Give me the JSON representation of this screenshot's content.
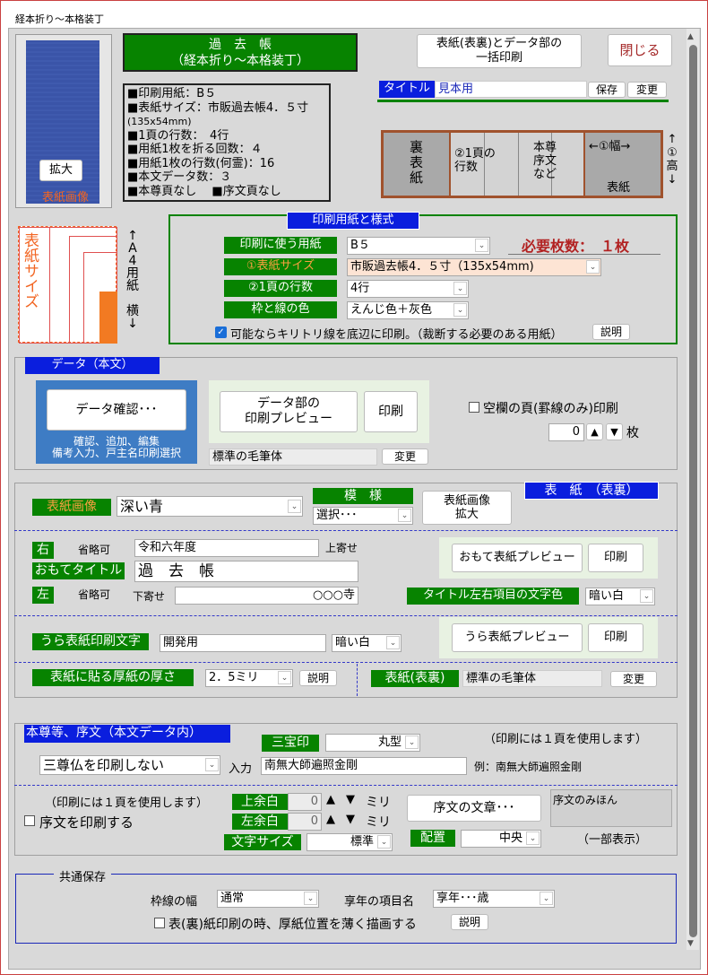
{
  "window": {
    "title": "経本折り～本格装丁"
  },
  "header": {
    "title_line1": "過　去　帳",
    "title_line2": "（経本折り～本格装丁）",
    "batch_print": "表紙(表裏)とデータ部の\n一括印刷",
    "close": "閉じる"
  },
  "cover_thumb": {
    "zoom": "拡大",
    "label": "表紙画像"
  },
  "info_lines": [
    "■印刷用紙：B５",
    "■表紙サイズ：市販過去帳4．５寸",
    "(135x54mm)",
    "■1頁の行数：　4行",
    "■用紙1枚を折る回数：４",
    "■用紙1枚の行数(何霊)：16",
    "■本文データ数：３",
    "■本尊頁なし　 ■序文頁なし"
  ],
  "title_row": {
    "label": "タイトル",
    "value": "見本用",
    "save": "保存",
    "change": "変更"
  },
  "layout_diagram": {
    "back_cover": "裏\n表\n紙",
    "lines": "②1頁の\n行数",
    "honzon": "本尊\n序文\nなど",
    "width": "←①幅→",
    "cover": "表紙",
    "height": "↑\n①\n高\n↓"
  },
  "paper_diagram": {
    "size_label": "表紙サイズ",
    "a4": "↑\nA\n4\n用\n紙\n\n横\n↓"
  },
  "paper_section": {
    "heading": "印刷用紙と様式",
    "paper_label": "印刷に使う用紙",
    "paper_value": "B５",
    "required": "必要枚数：　１枚",
    "cover_size_label": "①表紙サイズ",
    "cover_size_value": "市販過去帳4．５寸（135x54mm)",
    "lines_label": "②1頁の行数",
    "lines_value": "4行",
    "color_label": "枠と線の色",
    "color_value": "えんじ色＋灰色",
    "cut_line": "可能ならキリトリ線を底辺に印刷。（裁断する必要のある用紙）",
    "explain": "説明"
  },
  "data_section": {
    "heading": "データ（本文）",
    "confirm": "データ確認･･･",
    "confirm_note": "確認、追加、編集\n備考入力、戸主名印刷選択",
    "preview": "データ部の\n印刷プレビュー",
    "print": "印刷",
    "font": "標準の毛筆体",
    "change": "変更",
    "blank_pages": "空欄の頁(罫線のみ)印刷",
    "count": "0",
    "unit": "枚"
  },
  "cover_section": {
    "image_label": "表紙画像",
    "image_value": "深い青",
    "pattern_label": "模　様",
    "pattern_value": "選択･･･",
    "zoom": "表紙画像\n拡大",
    "heading": "表　紙　（表裏）",
    "right_label": "右",
    "omit": "省略可",
    "right_value": "令和六年度",
    "top_align": "上寄せ",
    "front_title_label": "おもてタイトル",
    "front_title_value": "過　去　帳",
    "left_label": "左",
    "bottom_align": "下寄せ",
    "left_value": "○○○寺",
    "front_preview": "おもて表紙プレビュー",
    "print": "印刷",
    "title_color_label": "タイトル左右項目の文字色",
    "title_color_value": "暗い白",
    "back_text_label": "うら表紙印刷文字",
    "back_text_value": "開発用",
    "back_color_value": "暗い白",
    "back_preview": "うら表紙プレビュー",
    "thickness_label": "表紙に貼る厚紙の厚さ",
    "thickness_value": "2．5ミリ",
    "explain": "説明",
    "cover_font_label": "表紙(表裏)",
    "cover_font_value": "標準の毛筆体",
    "change": "変更"
  },
  "honzon_section": {
    "heading": "本尊等、序文（本文データ内）",
    "sanpo_label": "三宝印",
    "sanpo_value": "丸型",
    "note": "（印刷には１頁を使用します）",
    "sanson_value": "三尊仏を印刷しない",
    "input_label": "入力",
    "input_value": "南無大師遍照金剛",
    "example": "例：南無大師遍照金剛",
    "note2": "（印刷には１頁を使用します）",
    "print_preface": "序文を印刷する",
    "top_margin_label": "上余白",
    "top_margin_value": "0",
    "left_margin_label": "左余白",
    "left_margin_value": "0",
    "mm": "ミリ",
    "preface_button": "序文の文章･･･",
    "preface_sample": "序文のみほん",
    "partial": "（一部表示）",
    "font_size_label": "文字サイズ",
    "font_size_value": "標準",
    "position_label": "配置",
    "position_value": "中央"
  },
  "common_section": {
    "heading": "共通保存",
    "frame_label": "枠線の幅",
    "frame_value": "通常",
    "kyonen_label": "享年の項目名",
    "kyonen_value": "享年･･･歳",
    "thin_draw": "表(裏)紙印刷の時、厚紙位置を薄く描画する",
    "explain": "説明"
  },
  "colors": {
    "green": "#078300",
    "blue": "#0a1ede",
    "orange": "#f26522",
    "brown": "#a0522d"
  }
}
